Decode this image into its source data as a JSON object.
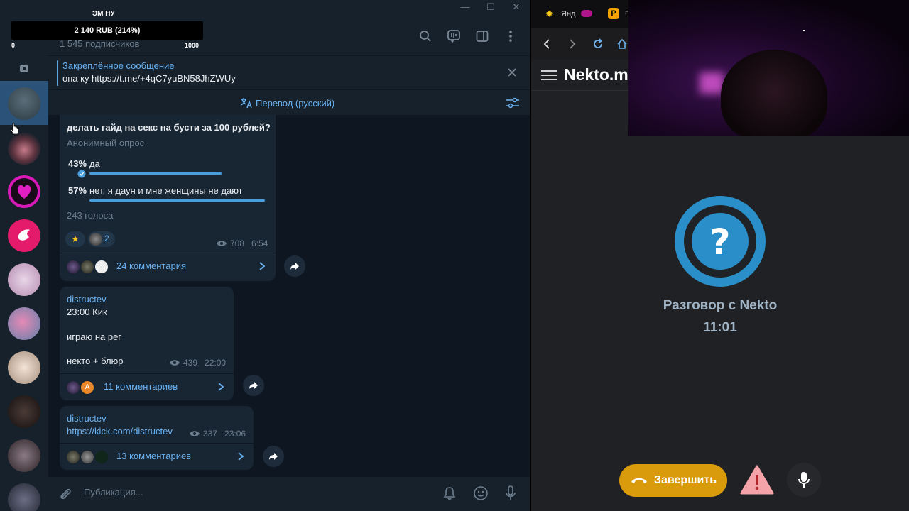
{
  "telegram": {
    "donation": {
      "title": "ЭМ НУ",
      "amount": "2 140 RUB (214%)",
      "min": "0",
      "max": "1000",
      "progress_percent": 214
    },
    "subscribers": "1 545 подписчиков",
    "pinned": {
      "title": "Закреплённое сообщение",
      "text": "опа ку https://t.me/+4qC7yuBN58JhZWUy"
    },
    "translate_label": "Перевод (русский)",
    "poll": {
      "question": "делать гайд на секс на бусти за 100 рублей?",
      "type": "Анонимный опрос",
      "options": [
        {
          "percent": "43%",
          "label": "да",
          "value": 43
        },
        {
          "percent": "57%",
          "label": "нет, я даун и мне женщины не дают",
          "value": 57
        }
      ],
      "votes": "243 голоса",
      "reaction_count": "2",
      "views": "708",
      "time": "6:54",
      "comments": "24 комментария"
    },
    "post2": {
      "author": "distructev",
      "line1": "23:00 Кик",
      "line2": "играю на рег",
      "line3": "некто + блюр",
      "views": "439",
      "time": "22:00",
      "comments": "11 комментариев",
      "avatar_letter": "A"
    },
    "post3": {
      "author": "distructev",
      "link": "https://kick.com/distructev",
      "views": "337",
      "time": "23:06",
      "comments": "13 комментариев"
    },
    "composer_placeholder": "Публикация...",
    "accent": "#6ab3f3"
  },
  "browser": {
    "tab1": "Янд",
    "tab2": "П",
    "site_title": "Nekto.m",
    "conversation_title": "Разговор с Nekto",
    "conversation_time": "11:01",
    "end_button": "Завершить",
    "end_button_color": "#d99a0b"
  }
}
